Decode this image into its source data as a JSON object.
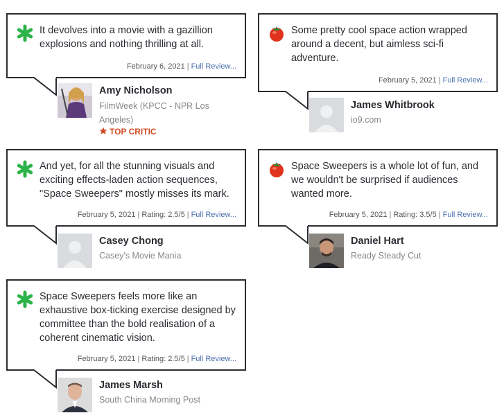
{
  "reviews": [
    {
      "rating_icon": "rotten-splat-icon",
      "quote": "It devolves into a movie with a gazillion explosions and nothing thrilling at all.",
      "date": "February 6, 2021",
      "rating": "",
      "full_review": "Full Review...",
      "critic": "Amy Nicholson",
      "publication": "FilmWeek (KPCC - NPR Los Angeles)",
      "top_critic": "TOP CRITIC"
    },
    {
      "rating_icon": "fresh-tomato-icon",
      "quote": "Some pretty cool space action wrapped around a decent, but aimless sci-fi adventure.",
      "date": "February 5, 2021",
      "rating": "",
      "full_review": "Full Review...",
      "critic": "James Whitbrook",
      "publication": "io9.com",
      "top_critic": ""
    },
    {
      "rating_icon": "rotten-splat-icon",
      "quote": "And yet, for all the stunning visuals and exciting effects-laden action sequences, \"Space Sweepers\" mostly misses its mark.",
      "date": "February 5, 2021",
      "rating": "Rating: 2.5/5",
      "full_review": "Full Review...",
      "critic": "Casey Chong",
      "publication": "Casey's Movie Mania",
      "top_critic": ""
    },
    {
      "rating_icon": "fresh-tomato-icon",
      "quote": "Space Sweepers is a whole lot of fun, and we wouldn't be surprised if audiences wanted more.",
      "date": "February 5, 2021",
      "rating": "Rating: 3.5/5",
      "full_review": "Full Review...",
      "critic": "Daniel Hart",
      "publication": "Ready Steady Cut",
      "top_critic": ""
    },
    {
      "rating_icon": "rotten-splat-icon",
      "quote": "Space Sweepers feels more like an exhaustive box-ticking exercise designed by committee than the bold realisation of a coherent cinematic vision.",
      "date": "February 5, 2021",
      "rating": "Rating: 2.5/5",
      "full_review": "Full Review...",
      "critic": "James Marsh",
      "publication": "South China Morning Post",
      "top_critic": ""
    }
  ],
  "separator": "|",
  "colors": {
    "rotten": "#2cb34a",
    "fresh": "#e0321c",
    "top_critic": "#d14b22",
    "link": "#4a6fae",
    "border": "#2a2c32"
  }
}
